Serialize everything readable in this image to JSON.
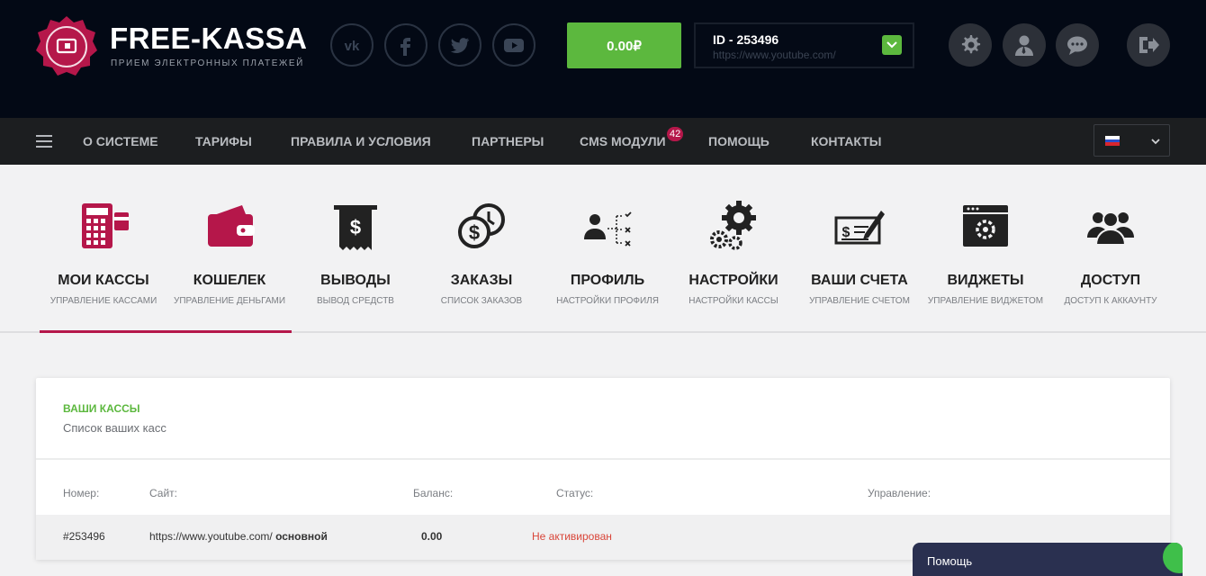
{
  "brand": {
    "title": "FREE-KASSA",
    "subtitle": "ПРИЕМ ЭЛЕКТРОННЫХ ПЛАТЕЖЕЙ",
    "accent": "#b5174a"
  },
  "social": [
    {
      "name": "vk-icon"
    },
    {
      "name": "facebook-icon"
    },
    {
      "name": "twitter-icon"
    },
    {
      "name": "youtube-icon"
    }
  ],
  "balance": {
    "label": "0.00₽",
    "color": "#5cb83e"
  },
  "account": {
    "id": "ID - 253496",
    "url": "https://www.youtube.com/"
  },
  "header_buttons": [
    {
      "name": "gear-icon"
    },
    {
      "name": "user-icon"
    },
    {
      "name": "chat-icon"
    },
    {
      "name": "logout-icon"
    }
  ],
  "nav": {
    "items": [
      "О СИСТЕМЕ",
      "ТАРИФЫ",
      "ПРАВИЛА И УСЛОВИЯ",
      "ПАРТНЕРЫ",
      "CMS МОДУЛИ",
      "ПОМОЩЬ",
      "КОНТАКТЫ"
    ],
    "cms_badge": "42",
    "language": "ru-flag-icon"
  },
  "menu": [
    {
      "title": "МОИ КАССЫ",
      "subtitle": "УПРАВЛЕНИЕ КАССАМИ",
      "icon": "calculator-icon",
      "active": true
    },
    {
      "title": "КОШЕЛЕК",
      "subtitle": "УПРАВЛЕНИЕ ДЕНЬГАМИ",
      "icon": "wallet-icon"
    },
    {
      "title": "ВЫВОДЫ",
      "subtitle": "ВЫВОД СРЕДСТВ",
      "icon": "receipt-icon"
    },
    {
      "title": "ЗАКАЗЫ",
      "subtitle": "СПИСОК ЗАКАЗОВ",
      "icon": "coins-icon"
    },
    {
      "title": "ПРОФИЛЬ",
      "subtitle": "НАСТРОЙКИ ПРОФИЛЯ",
      "icon": "profile-icon"
    },
    {
      "title": "НАСТРОЙКИ",
      "subtitle": "НАСТРОЙКИ КАССЫ",
      "icon": "gears-icon"
    },
    {
      "title": "ВАШИ СЧЕТА",
      "subtitle": "УПРАВЛЕНИЕ СЧЕТОМ",
      "icon": "cheque-icon"
    },
    {
      "title": "ВИДЖЕТЫ",
      "subtitle": "УПРАВЛЕНИЕ ВИДЖЕТОМ",
      "icon": "widget-icon"
    },
    {
      "title": "ДОСТУП",
      "subtitle": "ДОСТУП К АККАУНТУ",
      "icon": "users-icon"
    }
  ],
  "card": {
    "title": "ВАШИ КАССЫ",
    "subtitle": "Список ваших касс",
    "columns": [
      "Номер:",
      "Сайт:",
      "Баланс:",
      "Статус:",
      "Управление:"
    ],
    "rows": [
      {
        "number": "#253496",
        "site": "https://www.youtube.com/",
        "tag": "основной",
        "balance": "0.00",
        "status": "Не активирован"
      }
    ]
  },
  "help": {
    "label": "Помощь"
  }
}
